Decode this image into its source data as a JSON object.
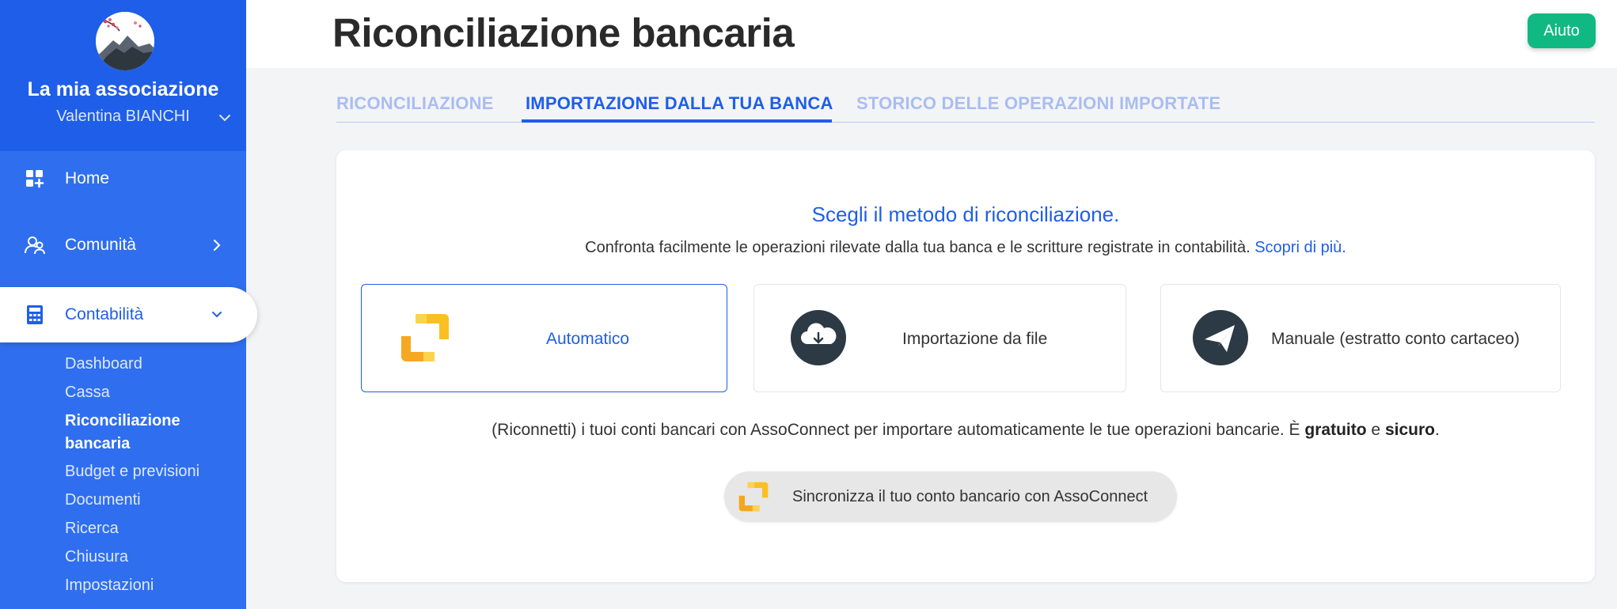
{
  "org": {
    "name": "La mia associazione",
    "user": "Valentina BIANCHI"
  },
  "nav": [
    {
      "label": "Home",
      "icon": "dashboard-grid-icon"
    },
    {
      "label": "Comunità",
      "icon": "users-icon"
    },
    {
      "label": "Contabilità",
      "icon": "calculator-icon"
    }
  ],
  "submenu": [
    "Dashboard",
    "Cassa",
    "Riconciliazione",
    "bancaria",
    "Budget e previsioni",
    "Documenti",
    "Ricerca",
    "Chiusura",
    "Impostazioni"
  ],
  "header": {
    "title": "Riconciliazione bancaria",
    "help_label": "Aiuto"
  },
  "tabs": [
    {
      "label": "RICONCILIAZIONE",
      "active": false
    },
    {
      "label": "IMPORTAZIONE DALLA TUA BANCA",
      "active": true
    },
    {
      "label": "STORICO DELLE OPERAZIONI IMPORTATE",
      "active": false
    }
  ],
  "card": {
    "title": "Scegli il metodo di riconciliazione.",
    "subtitle": "Confronta facilmente le operazioni rilevate dalla tua banca e le scritture registrate in contabilità.",
    "link": "Scopri di più.",
    "methods": [
      {
        "label": "Automatico",
        "icon": "sync-arrows-icon",
        "selected": true
      },
      {
        "label": "Importazione da file",
        "icon": "cloud-download-icon",
        "selected": false
      },
      {
        "label": "Manuale (estratto conto cartaceo)",
        "icon": "paper-plane-icon",
        "selected": false
      }
    ],
    "desc_part1": "(Riconnetti) i tuoi conti bancari con AssoConnect per importare automaticamente le tue operazioni bancarie. È",
    "desc_bold1": "gratuito",
    "desc_mid": "e",
    "desc_bold2": "sicuro",
    "desc_end": ".",
    "sync_label": "Sincronizza il tuo conto bancario con AssoConnect"
  },
  "colors": {
    "primary": "#1f5ee8",
    "sidebar": "#2f6fef",
    "help": "#10b981",
    "accent_yellow": "#fbbf24",
    "dark_icon": "#2b3a44"
  }
}
